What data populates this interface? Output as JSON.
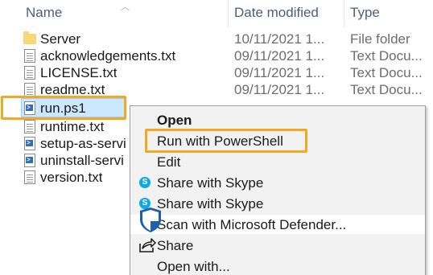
{
  "header": {
    "col_name": "Name",
    "col_date": "Date modified",
    "col_type": "Type"
  },
  "files": [
    {
      "name": "Server",
      "date": "10/11/2021 1...",
      "type": "File folder",
      "icon": "folder-icon"
    },
    {
      "name": "acknowledgements.txt",
      "date": "09/11/2021 1...",
      "type": "Text Docu...",
      "icon": "text-file-icon"
    },
    {
      "name": "LICENSE.txt",
      "date": "09/11/2021 1...",
      "type": "Text Docu...",
      "icon": "text-file-icon"
    },
    {
      "name": "readme.txt",
      "date": "09/11/2021 1...",
      "type": "Text Docu...",
      "icon": "text-file-icon"
    },
    {
      "name": "run.ps1",
      "date": "",
      "type": "",
      "icon": "powershell-file-icon"
    },
    {
      "name": "runtime.txt",
      "date": "",
      "type": "",
      "icon": "text-file-icon"
    },
    {
      "name": "setup-as-servi",
      "date": "",
      "type": "",
      "icon": "powershell-file-icon"
    },
    {
      "name": "uninstall-servi",
      "date": "",
      "type": "",
      "icon": "powershell-file-icon"
    },
    {
      "name": "version.txt",
      "date": "",
      "type": "",
      "icon": "text-file-icon"
    }
  ],
  "context_menu": {
    "items": [
      {
        "label": "Open",
        "bold": true
      },
      {
        "label": "Run with PowerShell"
      },
      {
        "label": "Edit"
      },
      {
        "label": "Share with Skype",
        "icon": "skype-icon"
      },
      {
        "label": "Share with Skype",
        "icon": "skype-icon"
      },
      {
        "label": "Scan with Microsoft Defender...",
        "icon": "defender-shield-icon"
      },
      {
        "label": "Share",
        "icon": "share-icon"
      },
      {
        "label": "Open with..."
      }
    ]
  },
  "colors": {
    "selection_bg": "#cce8ff",
    "highlight_outline": "#f5a623",
    "menu_bg": "#f2f2f2"
  }
}
